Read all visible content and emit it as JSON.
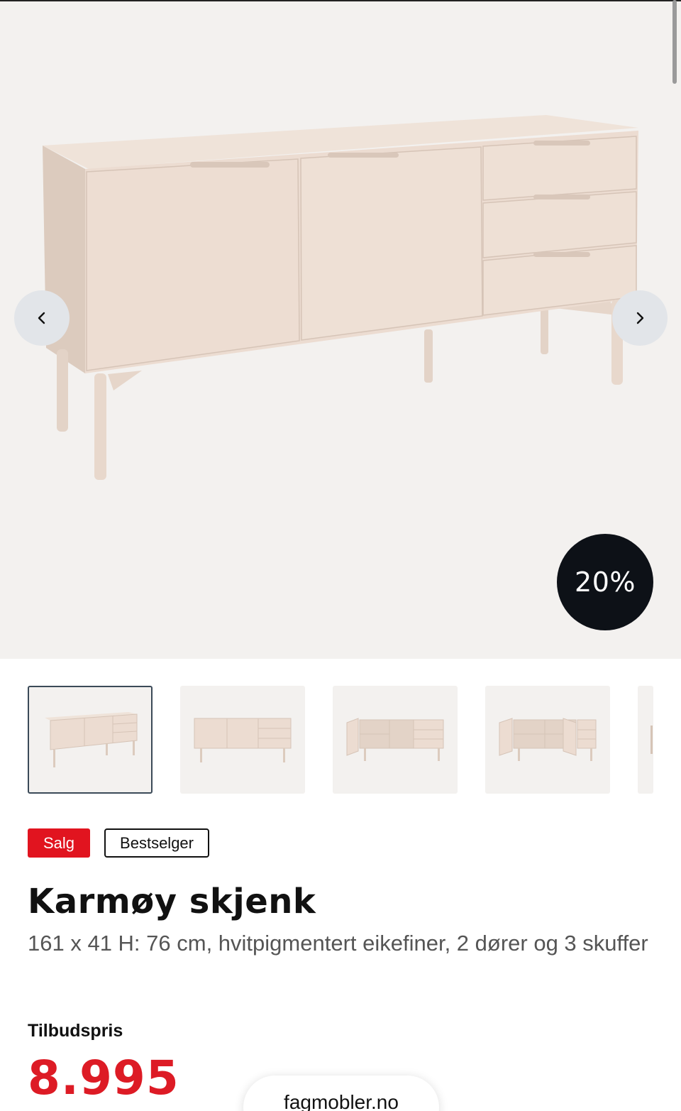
{
  "product": {
    "discount_badge": "20%",
    "tags": {
      "sale": "Salg",
      "bestseller": "Bestselger"
    },
    "title": "Karmøy skjenk",
    "description": "161 x 41 H: 76 cm, hvitpigmentert eikefiner, 2 dører og 3 skuffer",
    "price_label": "Tilbudspris",
    "price": "8.995"
  },
  "browser": {
    "url": "fagmobler.no"
  },
  "colors": {
    "sale_red": "#e1141f",
    "price_red": "#dd1b25",
    "badge_dark": "#0d1117",
    "image_bg": "#f3f1ef",
    "wood": "#ecdcd1"
  },
  "icons": {
    "prev": "chevron-left-icon",
    "next": "chevron-right-icon"
  }
}
